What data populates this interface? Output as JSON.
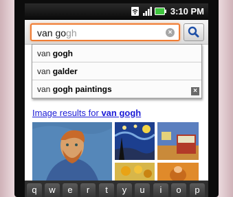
{
  "status_bar": {
    "time": "3:10 PM",
    "icons": [
      "wifi-icon",
      "signal-icon",
      "battery-icon"
    ]
  },
  "search": {
    "typed_text": "van go",
    "predicted_text": "gh",
    "clear_icon": "clear-icon",
    "search_icon": "magnifier-icon",
    "accent_color": "#f07c33"
  },
  "suggestions": [
    {
      "prefix": "van ",
      "bold": "gogh",
      "rest": ""
    },
    {
      "prefix": "van ",
      "bold": "galder",
      "rest": ""
    },
    {
      "prefix": "van ",
      "bold": "gogh",
      "rest": " paintings"
    }
  ],
  "results": {
    "header_prefix": "Image results for ",
    "header_query": "van gogh"
  },
  "keyboard": {
    "keys": [
      "q",
      "w",
      "e",
      "r",
      "t",
      "y",
      "u",
      "i",
      "o",
      "p"
    ]
  }
}
